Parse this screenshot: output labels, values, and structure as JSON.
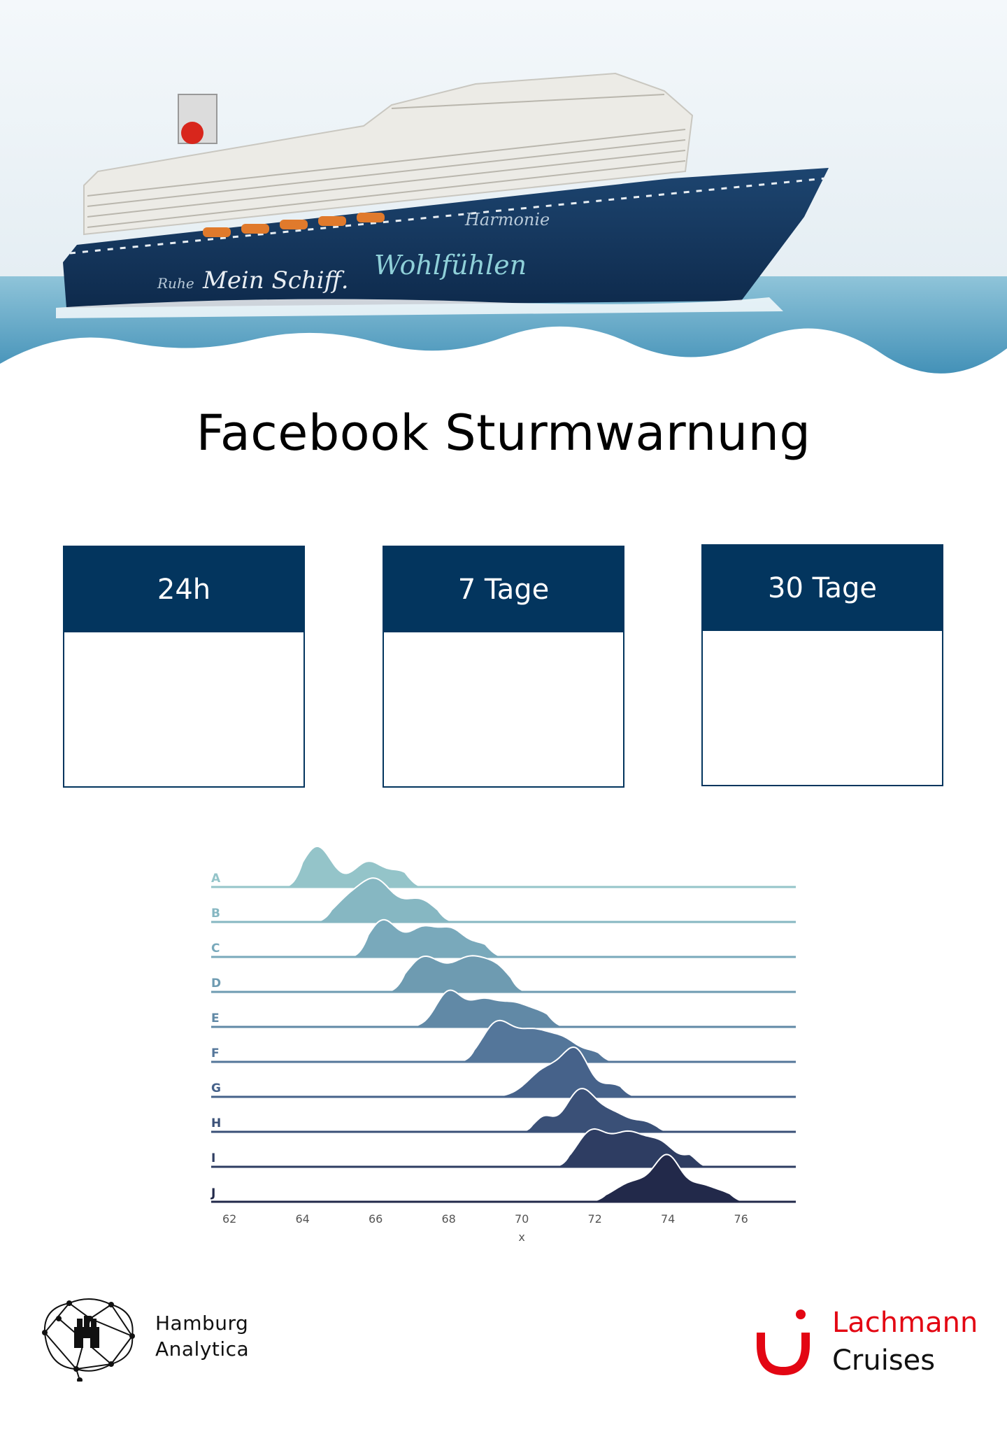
{
  "hero": {
    "ship_hull_names": [
      "Mein Schiff.",
      "Wohlfühlen",
      "Harmonie",
      "Ruhe"
    ]
  },
  "page_title": "Facebook Sturmwarnung",
  "cards": [
    {
      "label": "24h"
    },
    {
      "label": "7 Tage"
    },
    {
      "label": "30 Tage"
    }
  ],
  "chart_data": {
    "type": "ridgeline",
    "xlabel": "x",
    "xlim": [
      61.5,
      77.5
    ],
    "xticks": [
      62,
      64,
      66,
      68,
      70,
      72,
      74,
      76
    ],
    "colors": [
      "#94c4c9",
      "#86b7c2",
      "#79a9bb",
      "#6e9bb1",
      "#6189a6",
      "#54769a",
      "#46628a",
      "#3a5077",
      "#2e3d62",
      "#22294a"
    ],
    "series": [
      {
        "name": "A",
        "range": [
          63.5,
          67.3
        ],
        "peaks": [
          [
            64.4,
            1.0,
            0.4
          ],
          [
            65.8,
            0.62,
            0.4
          ],
          [
            66.7,
            0.35,
            0.35
          ]
        ]
      },
      {
        "name": "B",
        "range": [
          64.3,
          68.2
        ],
        "peaks": [
          [
            65.2,
            0.45,
            0.4
          ],
          [
            66.0,
            1.0,
            0.45
          ],
          [
            67.2,
            0.55,
            0.45
          ]
        ]
      },
      {
        "name": "C",
        "range": [
          65.3,
          69.5
        ],
        "peaks": [
          [
            66.2,
            0.9,
            0.4
          ],
          [
            67.3,
            0.7,
            0.4
          ],
          [
            68.1,
            0.6,
            0.35
          ],
          [
            68.9,
            0.3,
            0.35
          ]
        ]
      },
      {
        "name": "D",
        "range": [
          66.3,
          70.2
        ],
        "peaks": [
          [
            67.3,
            0.82,
            0.45
          ],
          [
            68.6,
            0.85,
            0.55
          ],
          [
            69.4,
            0.35,
            0.35
          ]
        ]
      },
      {
        "name": "E",
        "range": [
          66.7,
          71.2
        ],
        "peaks": [
          [
            68.0,
            0.85,
            0.35
          ],
          [
            68.9,
            0.6,
            0.4
          ],
          [
            69.8,
            0.55,
            0.45
          ],
          [
            70.6,
            0.25,
            0.35
          ]
        ]
      },
      {
        "name": "F",
        "range": [
          68.2,
          72.6
        ],
        "peaks": [
          [
            69.3,
            0.9,
            0.4
          ],
          [
            70.3,
            0.75,
            0.5
          ],
          [
            71.2,
            0.45,
            0.4
          ],
          [
            72.0,
            0.2,
            0.3
          ]
        ]
      },
      {
        "name": "G",
        "range": [
          68.8,
          73.2
        ],
        "peaks": [
          [
            70.7,
            0.7,
            0.5
          ],
          [
            71.5,
            1.0,
            0.35
          ],
          [
            72.5,
            0.3,
            0.35
          ]
        ]
      },
      {
        "name": "H",
        "range": [
          69.8,
          74.2
        ],
        "peaks": [
          [
            70.6,
            0.35,
            0.25
          ],
          [
            71.6,
            1.0,
            0.4
          ],
          [
            72.5,
            0.45,
            0.45
          ],
          [
            73.4,
            0.2,
            0.3
          ]
        ]
      },
      {
        "name": "I",
        "range": [
          70.8,
          75.1
        ],
        "peaks": [
          [
            71.9,
            0.85,
            0.4
          ],
          [
            72.9,
            0.8,
            0.45
          ],
          [
            73.8,
            0.55,
            0.4
          ],
          [
            74.7,
            0.25,
            0.25
          ]
        ]
      },
      {
        "name": "J",
        "range": [
          71.8,
          76.2
        ],
        "peaks": [
          [
            73.1,
            0.5,
            0.55
          ],
          [
            74.0,
            1.0,
            0.35
          ],
          [
            74.9,
            0.4,
            0.4
          ],
          [
            75.6,
            0.15,
            0.3
          ]
        ]
      }
    ],
    "grid": false
  },
  "footer": {
    "left_logo_line1": "Hamburg",
    "left_logo_line2": "Analytica",
    "right_logo_name": "Lachmann",
    "right_logo_sub": "Cruises",
    "accent_red": "#e30613",
    "navy": "#03355e"
  }
}
